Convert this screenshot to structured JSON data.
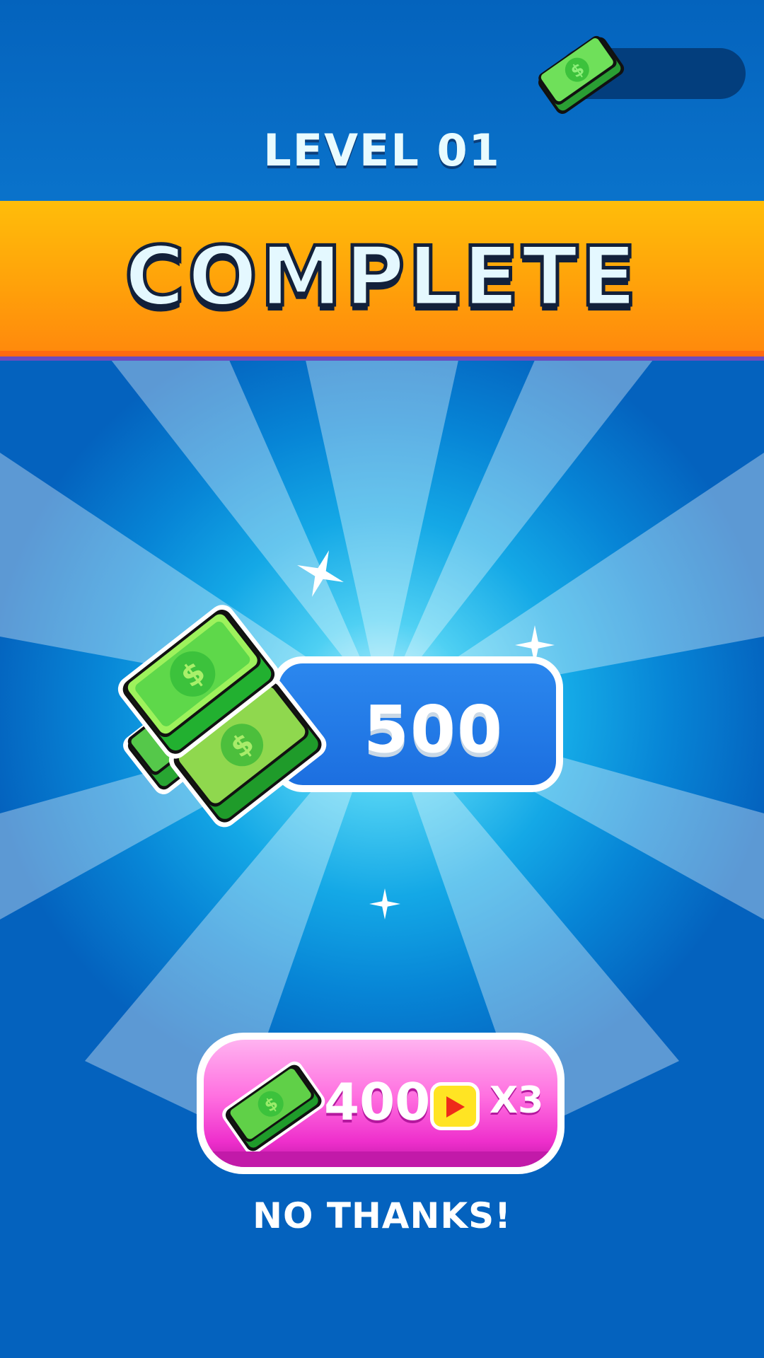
{
  "top_bar": {
    "coin_counter_value": "",
    "coin_icon": "cash-icon"
  },
  "level": {
    "title": "LEVEL 01"
  },
  "banner": {
    "title": "COMPLETE"
  },
  "reward": {
    "amount": "500",
    "icon": "cash-stack-icon"
  },
  "claim_button": {
    "amount": "400",
    "multiplier": "X3",
    "ad_icon": "play-video-icon"
  },
  "secondary_action": {
    "label": "NO THANKS!"
  },
  "colors": {
    "banner_orange": "#ffa20a",
    "button_pink": "#ff6fe0",
    "cash_green": "#3fcf47",
    "panel_blue": "#1c6fe0"
  }
}
